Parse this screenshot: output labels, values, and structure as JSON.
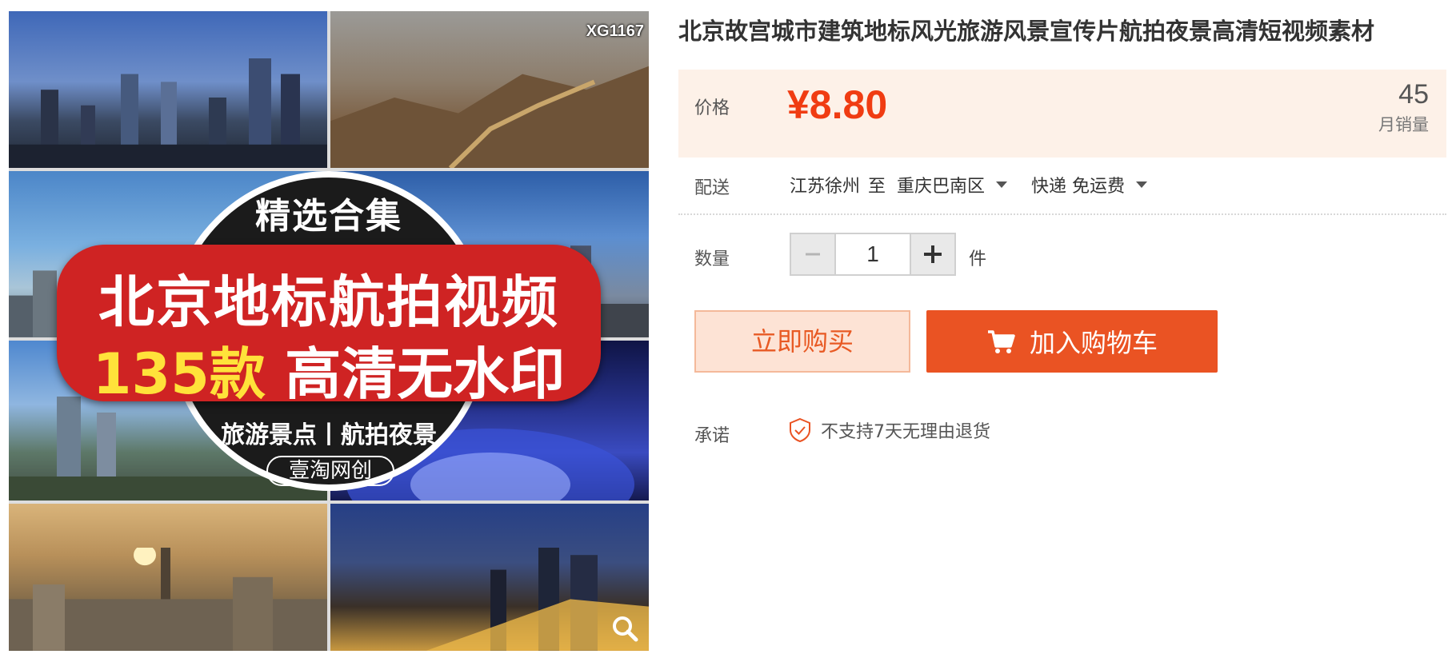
{
  "gallery": {
    "code": "XG1167",
    "banner_top": "精选合集",
    "banner_line1": "北京地标航拍视频",
    "banner_line2_highlight": "135款",
    "banner_line2_rest": " 高清无水印",
    "banner_sub": "旅游景点丨航拍夜景",
    "banner_brand": "壹淘网创"
  },
  "product": {
    "title": "北京故宫城市建筑地标风光旅游风景宣传片航拍夜景高清短视频素材"
  },
  "price": {
    "label": "价格",
    "value": "¥8.80",
    "sales_count": "45",
    "sales_label": "月销量"
  },
  "delivery": {
    "label": "配送",
    "from": "江苏徐州",
    "to_word": "至",
    "destination": "重庆巴南区",
    "shipping": "快递 免运费"
  },
  "quantity": {
    "label": "数量",
    "value": "1",
    "unit": "件"
  },
  "actions": {
    "buy_now": "立即购买",
    "add_to_cart": "加入购物车"
  },
  "promise": {
    "label": "承诺",
    "text": "不支持7天无理由退货"
  },
  "colors": {
    "accent": "#ea5323",
    "price": "#f03c12",
    "price_bg": "#fdf1e8"
  }
}
